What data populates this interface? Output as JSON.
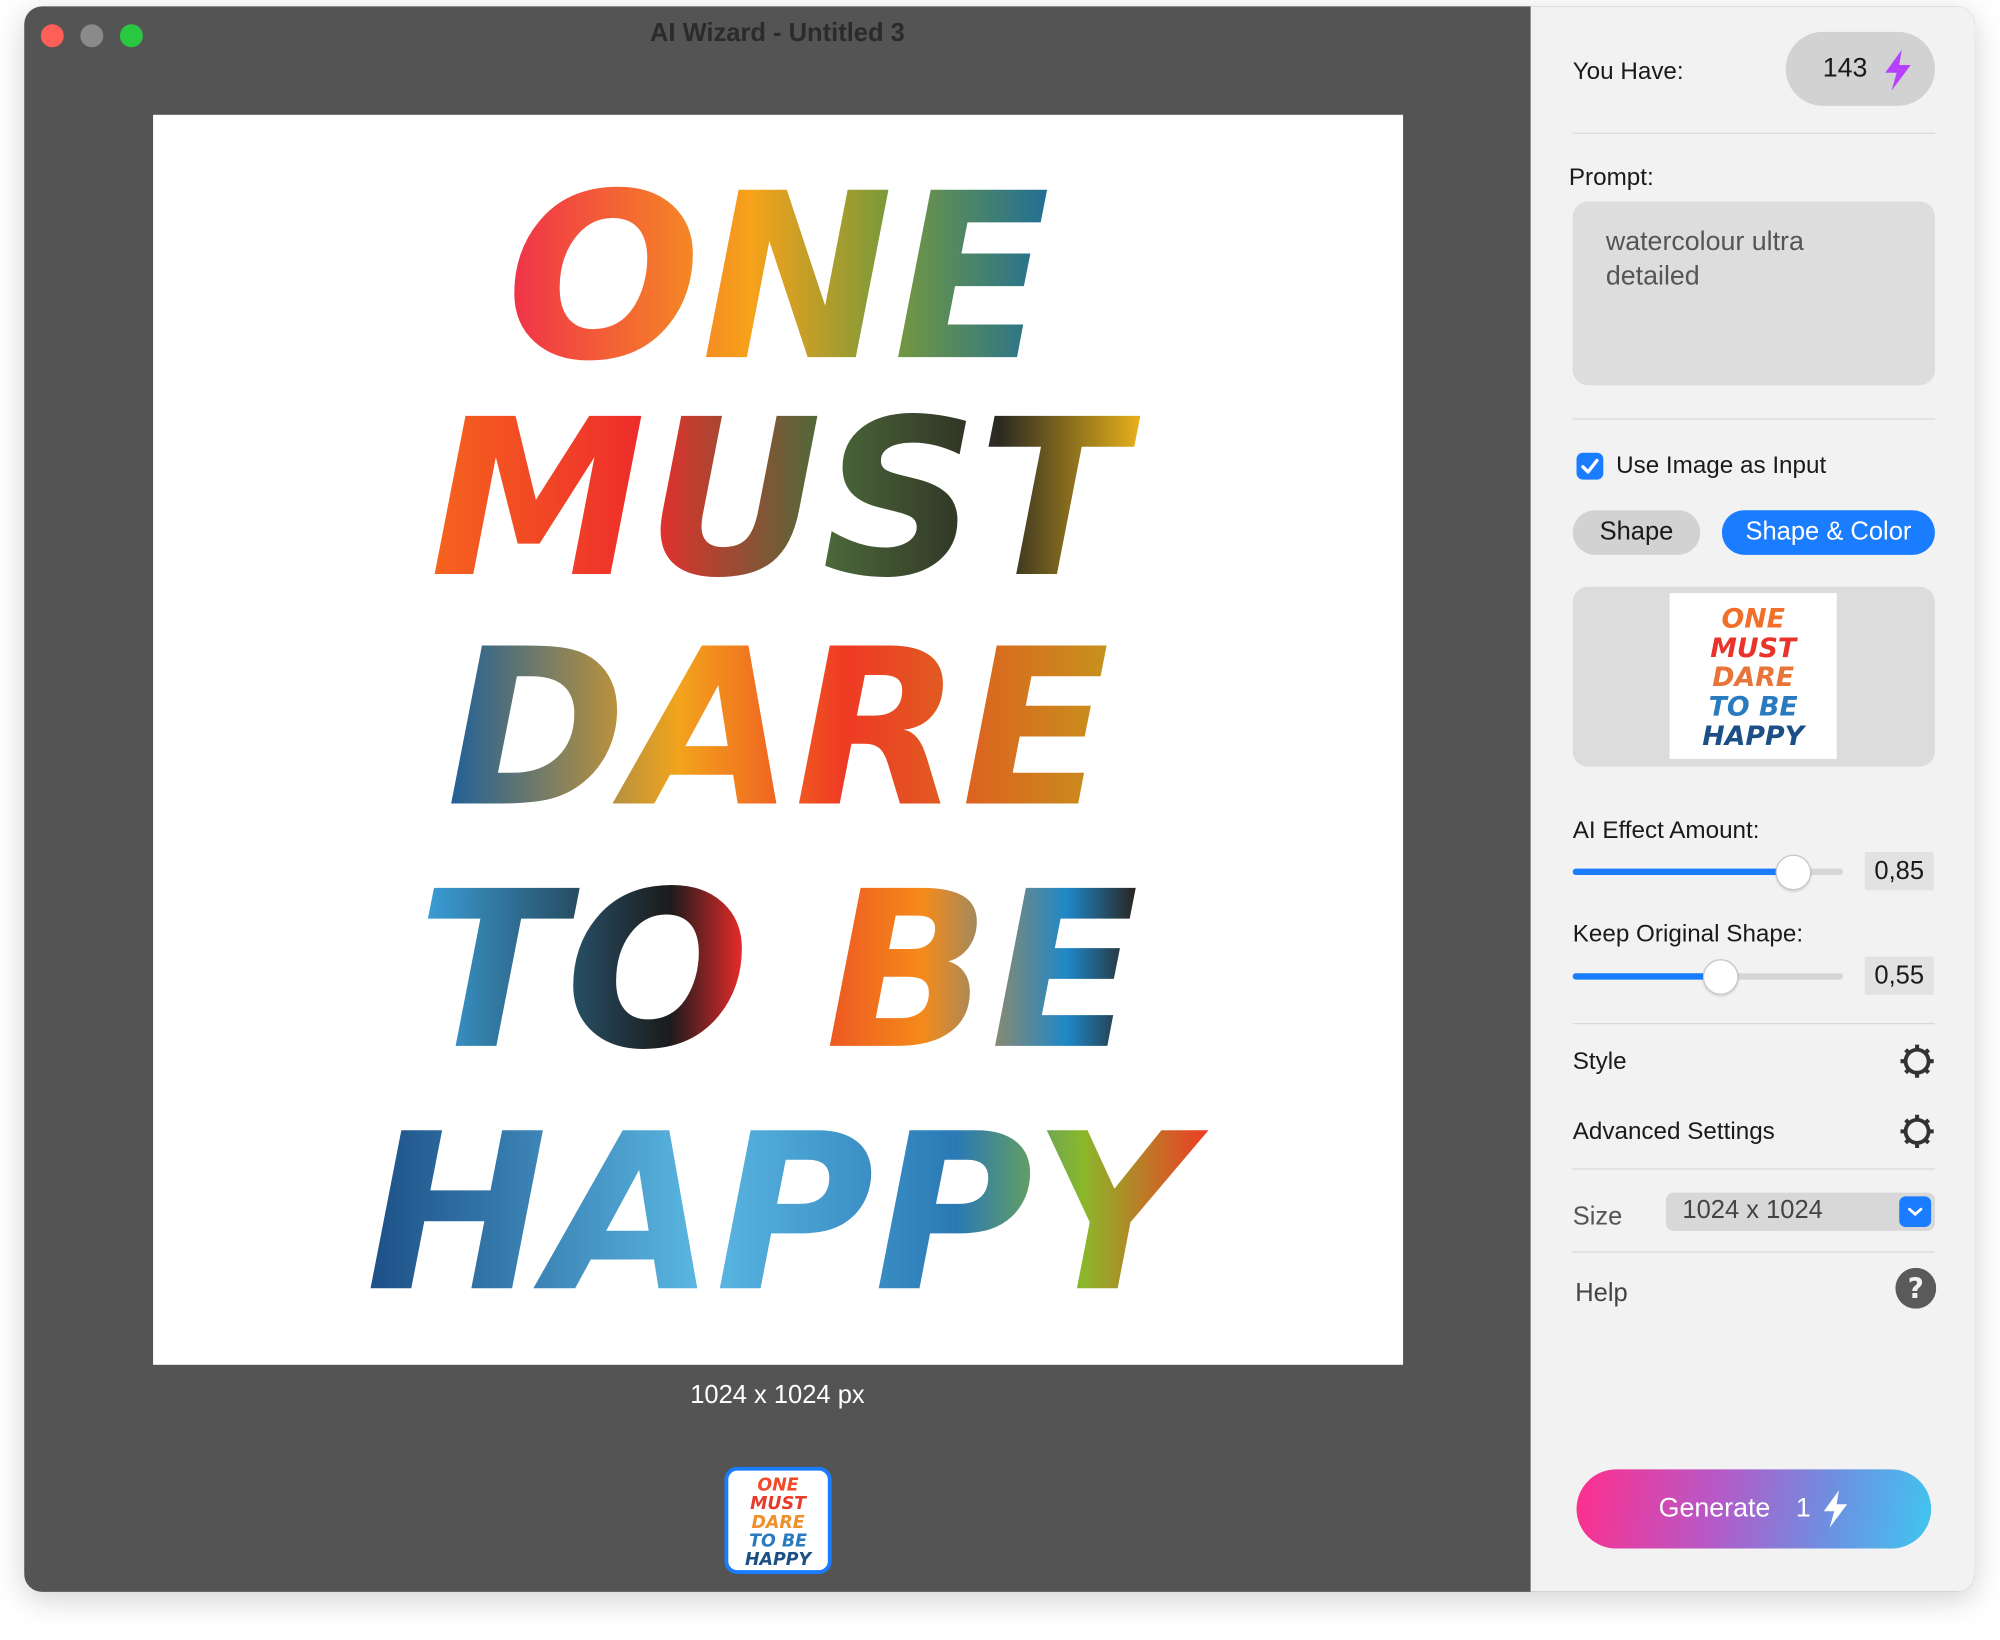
{
  "window": {
    "title": "AI Wizard - Untitled 3"
  },
  "canvas": {
    "artwork_lettering": [
      "ONE",
      "MUST",
      "DARE",
      "TO BE",
      "HAPPY"
    ],
    "dimensions": "1024 x 1024 px"
  },
  "sidebar": {
    "credits_label": "You Have:",
    "credits_value": "143",
    "prompt_label": "Prompt:",
    "prompt_value": "watercolour ultra detailed",
    "use_image_label": "Use Image as Input",
    "use_image_checked": true,
    "mode_options": [
      "Shape",
      "Shape & Color"
    ],
    "mode_selected": "Shape & Color",
    "ai_effect_label": "AI Effect Amount:",
    "ai_effect_value": "0,85",
    "ai_effect_fraction": 0.85,
    "keep_shape_label": "Keep Original Shape:",
    "keep_shape_value": "0,55",
    "keep_shape_fraction": 0.55,
    "style_label": "Style",
    "advanced_label": "Advanced Settings",
    "size_label": "Size",
    "size_value": "1024 x 1024",
    "help_label": "Help",
    "generate_label": "Generate",
    "generate_cost": "1"
  },
  "colors": {
    "accent": "#1a7cff",
    "bolt": "#b540ff",
    "canvas_bg": "#545454",
    "sidebar_bg": "#f2f2f2"
  },
  "icons": [
    "lightning-icon",
    "checkmark-icon",
    "gear-icon",
    "chevron-down-icon",
    "question-icon"
  ]
}
